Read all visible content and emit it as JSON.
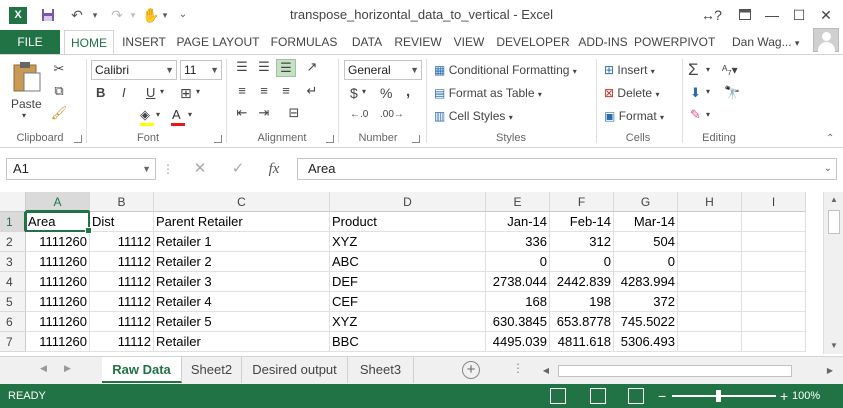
{
  "window": {
    "title": "transpose_horizontal_data_to_vertical - Excel",
    "app_icon": "X",
    "accent_color": "#217346"
  },
  "qat": {
    "save_icon": "floppy-disk-icon",
    "undo_icon": "undo-icon",
    "redo_icon": "redo-icon",
    "touch_icon": "touch-mode-icon"
  },
  "window_controls": {
    "help": "?",
    "restore_ribbon": "⬚",
    "minimize": "—",
    "maximize": "☐",
    "close": "✕"
  },
  "ribbon_tabs": [
    "FILE",
    "HOME",
    "INSERT",
    "PAGE LAYOUT",
    "FORMULAS",
    "DATA",
    "REVIEW",
    "VIEW",
    "DEVELOPER",
    "ADD-INS",
    "POWERPIVOT"
  ],
  "user_name": "Dan Wag...",
  "ribbon": {
    "clipboard": {
      "label": "Clipboard",
      "paste": "Paste"
    },
    "font": {
      "label": "Font",
      "font_name": "Calibri",
      "font_size": "11",
      "bold": "B",
      "italic": "I",
      "underline": "U",
      "grow": "A",
      "shrink": "A"
    },
    "alignment": {
      "label": "Alignment"
    },
    "number": {
      "label": "Number",
      "format": "General",
      "currency": "$",
      "percent": "%",
      "comma": ","
    },
    "styles": {
      "label": "Styles",
      "conditional": "Conditional Formatting",
      "format_table": "Format as Table",
      "cell_styles": "Cell Styles"
    },
    "cells": {
      "label": "Cells",
      "insert": "Insert",
      "delete": "Delete",
      "format": "Format"
    },
    "editing": {
      "label": "Editing",
      "sum": "Σ"
    }
  },
  "formula_bar": {
    "name_box": "A1",
    "value": "Area",
    "fx": "fx"
  },
  "grid": {
    "columns": [
      "A",
      "B",
      "C",
      "D",
      "E",
      "F",
      "G",
      "H",
      "I"
    ],
    "rows": [
      "1",
      "2",
      "3",
      "4",
      "5",
      "6",
      "7"
    ],
    "cells": [
      [
        "Area",
        "Dist",
        "Parent Retailer",
        "Product",
        "Jan-14",
        "Feb-14",
        "Mar-14",
        "",
        ""
      ],
      [
        "1111260",
        "11112",
        "Retailer 1",
        "XYZ",
        "336",
        "312",
        "504",
        "",
        ""
      ],
      [
        "1111260",
        "11112",
        "Retailer 2",
        "ABC",
        "0",
        "0",
        "0",
        "",
        ""
      ],
      [
        "1111260",
        "11112",
        "Retailer 3",
        "DEF",
        "2738.044",
        "2442.839",
        "4283.994",
        "",
        ""
      ],
      [
        "1111260",
        "11112",
        "Retailer 4",
        "CEF",
        "168",
        "198",
        "372",
        "",
        ""
      ],
      [
        "1111260",
        "11112",
        "Retailer 5",
        "XYZ",
        "630.3845",
        "653.8778",
        "745.5022",
        "",
        ""
      ],
      [
        "1111260",
        "11112",
        "Retailer",
        "BBC",
        "4495.039",
        "4811.618",
        "5306.493",
        "",
        ""
      ]
    ],
    "active_cell": "A1"
  },
  "sheets": [
    {
      "name": "Raw Data",
      "active": true
    },
    {
      "name": "Sheet2",
      "active": false
    },
    {
      "name": "Desired output",
      "active": false
    },
    {
      "name": "Sheet3",
      "active": false
    }
  ],
  "status": {
    "ready": "READY",
    "zoom": "100%"
  }
}
